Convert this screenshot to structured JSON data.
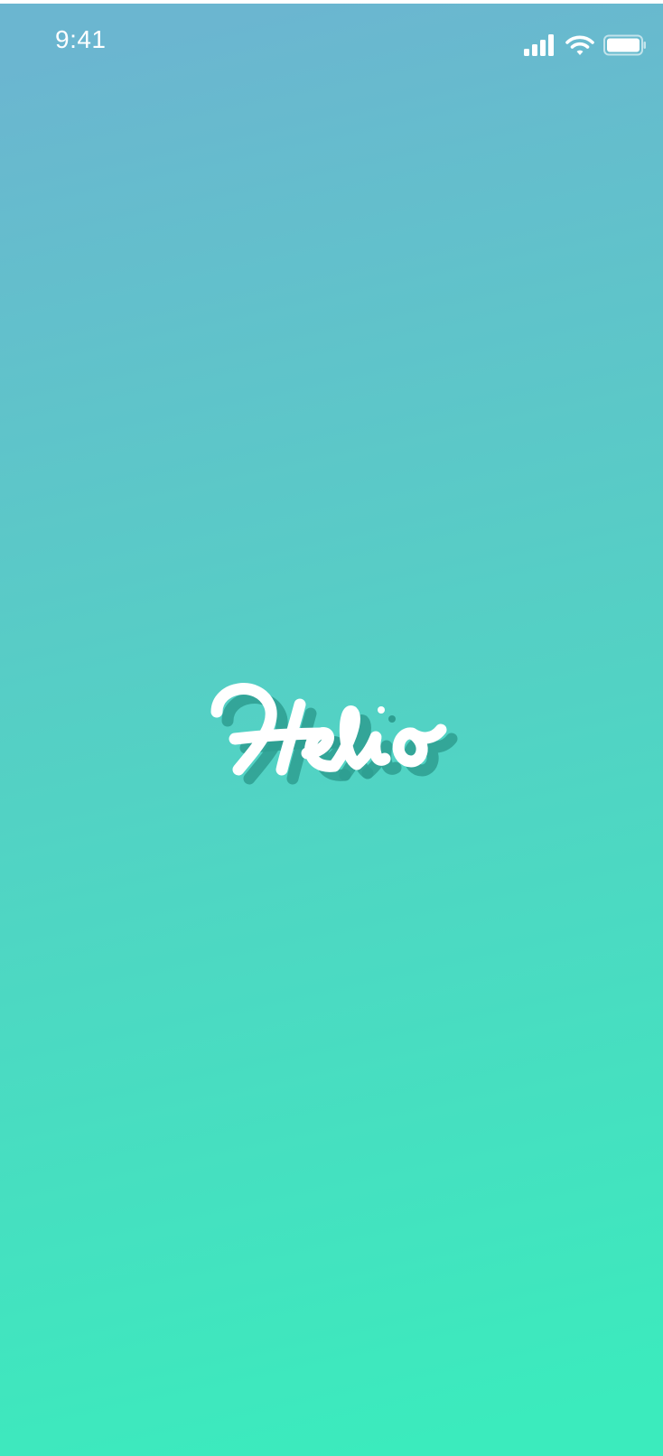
{
  "status_bar": {
    "time": "9:41",
    "icons": [
      "cellular-signal-icon",
      "wifi-icon",
      "battery-icon"
    ]
  },
  "splash": {
    "logo_text": "Helio"
  },
  "colors": {
    "gradient_top": "#6BB6D0",
    "gradient_bottom": "#3BEBBD",
    "logo": "#FFFFFF",
    "logo_shadow": "#2E9E91"
  }
}
